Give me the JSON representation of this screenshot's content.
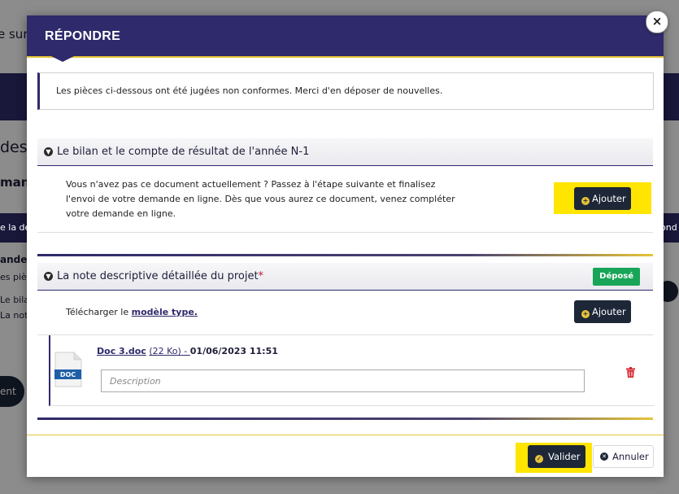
{
  "background": {
    "fragments": [
      "e sur",
      "des",
      "mand",
      "e la de",
      "ond",
      "ande",
      "es piè",
      "Le bilar",
      "La note",
      "ent"
    ]
  },
  "modal": {
    "title": "RÉPONDRE",
    "close_symbol": "×",
    "alert": "Les pièces ci-dessous ont été jugées non conformes. Merci d'en déposer de nouvelles.",
    "section1": {
      "title": "Le bilan et le compte de résultat de l'année N-1",
      "chevron_icon": "chevron-circle-down-icon",
      "text_line1": "Vous n'avez pas ce document actuellement ? Passez à l'étape suivante et finalisez",
      "text_line2": "l'envoi de votre demande en ligne. Dès que vous aurez ce document, venez compléter",
      "text_line3": "votre demande en ligne.",
      "add_button": "Ajouter"
    },
    "section2": {
      "title": "La note descriptive détaillée du projet",
      "required_mark": "*",
      "badge": "Déposé",
      "download_prefix": "Télécharger le",
      "download_link": "modèle type.",
      "add_button": "Ajouter",
      "file": {
        "icon_label": "DOC",
        "name": "Doc 3.doc",
        "size": "(22 Ko)",
        "separator": " - ",
        "date": "01/06/2023 11:51",
        "description_placeholder": "Description",
        "delete_icon": "trash-icon"
      }
    },
    "footer": {
      "validate_button": "Valider",
      "cancel_button": "Annuler"
    }
  },
  "colors": {
    "primary": "#2f2a6b",
    "accent": "#e6c43a",
    "highlight": "#ffe500",
    "success": "#18a558",
    "danger": "#c0162e",
    "button_dark": "#1d2738"
  }
}
